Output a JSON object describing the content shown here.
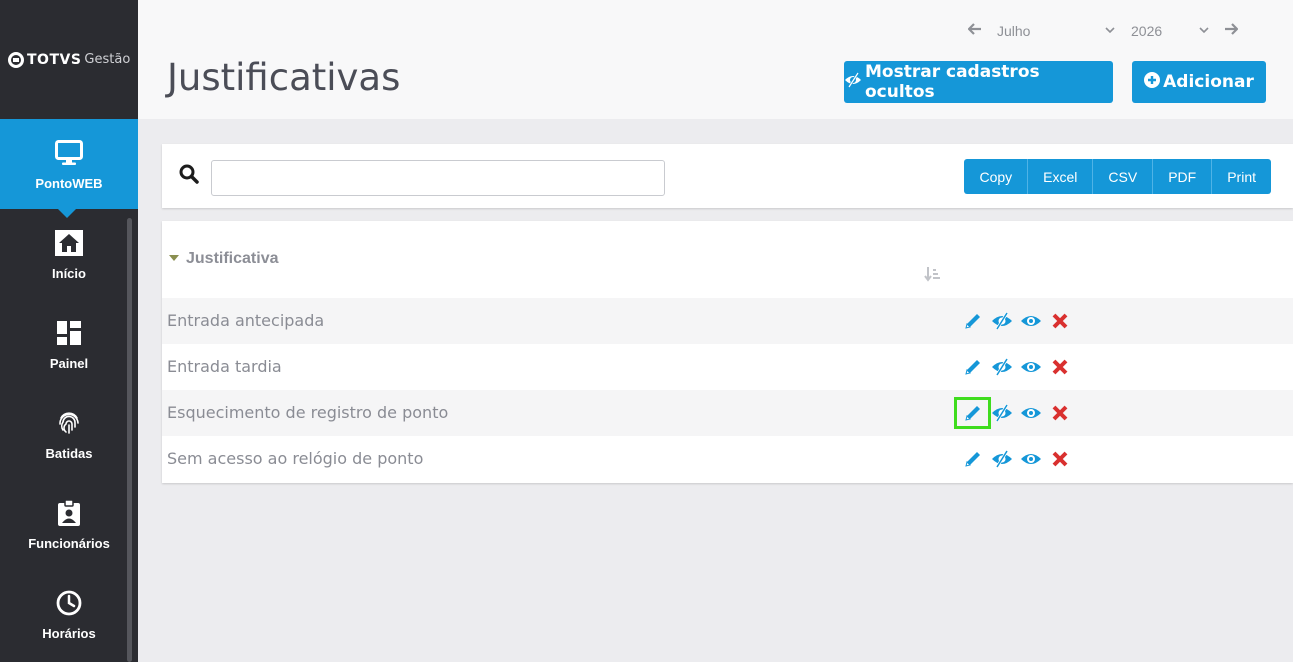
{
  "brand": {
    "name": "TOTVS",
    "product": "Gestão"
  },
  "sidebar": {
    "items": [
      {
        "label": "PontoWEB",
        "icon": "monitor-icon",
        "active": true
      },
      {
        "label": "Início",
        "icon": "home-icon",
        "active": false
      },
      {
        "label": "Painel",
        "icon": "dashboard-icon",
        "active": false
      },
      {
        "label": "Batidas",
        "icon": "fingerprint-icon",
        "active": false
      },
      {
        "label": "Funcionários",
        "icon": "id-badge-icon",
        "active": false
      },
      {
        "label": "Horários",
        "icon": "clock-icon",
        "active": false
      }
    ]
  },
  "header": {
    "title": "Justificativas",
    "month": "Julho",
    "year": "2026",
    "show_hidden_label": "Mostrar cadastros ocultos",
    "add_label": "Adicionar"
  },
  "toolbar": {
    "search_value": "",
    "export_buttons": [
      "Copy",
      "Excel",
      "CSV",
      "PDF",
      "Print"
    ]
  },
  "table": {
    "column_label": "Justificativa",
    "rows": [
      "Entrada antecipada",
      "Entrada tardia",
      "Esquecimento de registro de ponto",
      "Sem acesso ao relógio de ponto"
    ]
  },
  "colors": {
    "accent": "#1597d8",
    "sidebar_bg": "#2b2c31",
    "delete": "#d9302f",
    "highlight": "#3fdc1e"
  }
}
